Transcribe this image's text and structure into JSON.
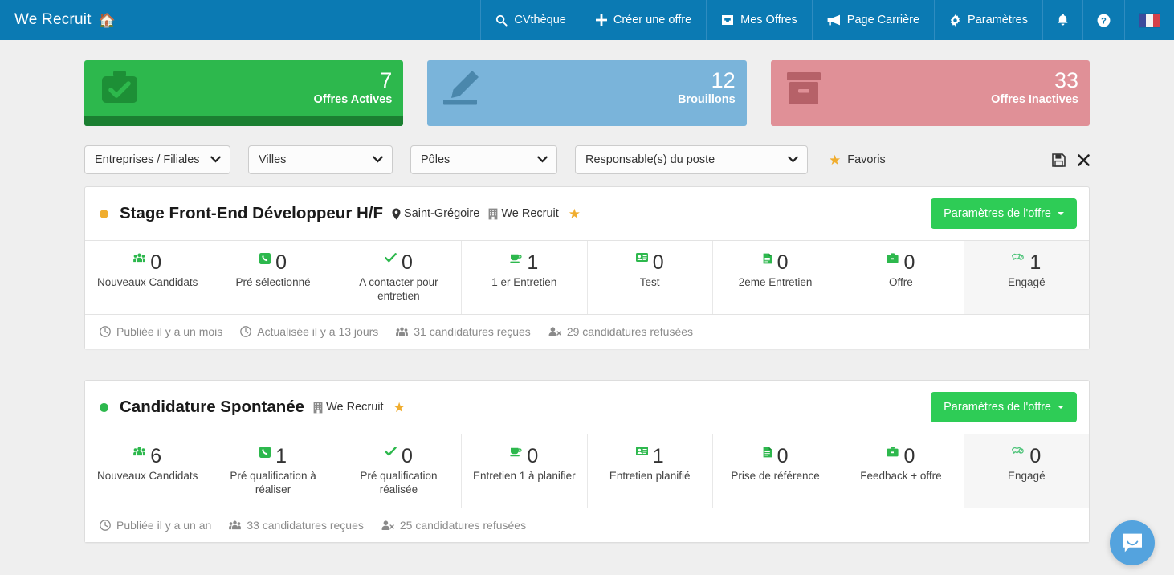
{
  "navbar": {
    "brand": "We Recruit",
    "brand_icon": "home-icon",
    "background": "#0b7ab3",
    "items": [
      {
        "label": "CVthèque",
        "icon": "search-icon"
      },
      {
        "label": "Créer une offre",
        "icon": "plus-icon"
      },
      {
        "label": "Mes Offres",
        "icon": "inbox-icon"
      },
      {
        "label": "Page Carrière",
        "icon": "bullhorn-icon"
      },
      {
        "label": "Paramètres",
        "icon": "gear-icon"
      }
    ],
    "icon_items": [
      {
        "icon": "bell-icon"
      },
      {
        "icon": "question-circle-icon"
      }
    ],
    "language_flag": "france-flag-icon"
  },
  "stat_cards": [
    {
      "value": "7",
      "label": "Offres Actives",
      "icon": "briefcase-check-icon",
      "bg": "#2db84d",
      "icon_color": "#1d8e37",
      "footer_color": "#1b7f31",
      "has_footer": true
    },
    {
      "value": "12",
      "label": "Brouillons",
      "icon": "pencil-icon",
      "bg": "#7ab4da",
      "icon_color": "#4a86ab",
      "footer_color": "",
      "has_footer": false
    },
    {
      "value": "33",
      "label": "Offres Inactives",
      "icon": "archive-icon",
      "bg": "#e09097",
      "icon_color": "#b56068",
      "footer_color": "",
      "has_footer": false
    }
  ],
  "filters": {
    "selects": [
      {
        "value": "Entreprises / Filiales",
        "icon": "chevron-down-icon"
      },
      {
        "value": "Villes",
        "icon": "chevron-down-icon"
      },
      {
        "value": "Pôles",
        "icon": "chevron-down-icon"
      },
      {
        "value": "Responsable(s) du poste",
        "icon": "chevron-down-icon"
      }
    ],
    "favoris_label": "Favoris",
    "favoris_icon": "star-icon",
    "save_icon": "floppy-save-icon",
    "clear_icon": "close-x-icon"
  },
  "jobs": [
    {
      "status_color": "#f0ad2e",
      "title": "Stage Front-End Développeur H/F",
      "location": "Saint-Grégoire",
      "location_icon": "map-marker-icon",
      "company": "We Recruit",
      "company_icon": "building-icon",
      "favorite_icon": "star-icon",
      "settings_button": "Paramètres de l'offre",
      "stages": [
        {
          "value": "0",
          "label": "Nouveaux Candidats",
          "icon": "users-icon"
        },
        {
          "value": "0",
          "label": "Pré sélectionné",
          "icon": "phone-square-icon"
        },
        {
          "value": "0",
          "label": "A contacter pour entretien",
          "icon": "check-icon"
        },
        {
          "value": "1",
          "label": "1 er Entretien",
          "icon": "coffee-icon"
        },
        {
          "value": "0",
          "label": "Test",
          "icon": "id-card-icon"
        },
        {
          "value": "0",
          "label": "2eme Entretien",
          "icon": "file-text-icon"
        },
        {
          "value": "0",
          "label": "Offre",
          "icon": "briefcase-icon"
        },
        {
          "value": "1",
          "label": "Engagé",
          "icon": "handshake-icon"
        }
      ],
      "footer": [
        {
          "text": "Publiée il y a un mois",
          "icon": "clock-icon"
        },
        {
          "text": "Actualisée il y a 13 jours",
          "icon": "clock-icon"
        },
        {
          "text": "31 candidatures reçues",
          "icon": "users-icon"
        },
        {
          "text": "29 candidatures refusées",
          "icon": "user-times-icon"
        }
      ]
    },
    {
      "status_color": "#2db84d",
      "title": "Candidature Spontanée",
      "location": "",
      "location_icon": "",
      "company": "We Recruit",
      "company_icon": "building-icon",
      "favorite_icon": "star-icon",
      "settings_button": "Paramètres de l'offre",
      "stages": [
        {
          "value": "6",
          "label": "Nouveaux Candidats",
          "icon": "users-icon"
        },
        {
          "value": "1",
          "label": "Pré qualification à réaliser",
          "icon": "phone-square-icon"
        },
        {
          "value": "0",
          "label": "Pré qualification réalisée",
          "icon": "check-icon"
        },
        {
          "value": "0",
          "label": "Entretien 1 à planifier",
          "icon": "coffee-icon"
        },
        {
          "value": "1",
          "label": "Entretien planifié",
          "icon": "id-card-icon"
        },
        {
          "value": "0",
          "label": "Prise de référence",
          "icon": "file-text-icon"
        },
        {
          "value": "0",
          "label": "Feedback + offre",
          "icon": "briefcase-icon"
        },
        {
          "value": "0",
          "label": "Engagé",
          "icon": "handshake-icon"
        }
      ],
      "footer": [
        {
          "text": "Publiée il y a un an",
          "icon": "clock-icon"
        },
        {
          "text": "33 candidatures reçues",
          "icon": "users-icon"
        },
        {
          "text": "25 candidatures refusées",
          "icon": "user-times-icon"
        }
      ]
    }
  ],
  "chat": {
    "icon": "chat-bubble-icon",
    "color": "#54a3de"
  }
}
